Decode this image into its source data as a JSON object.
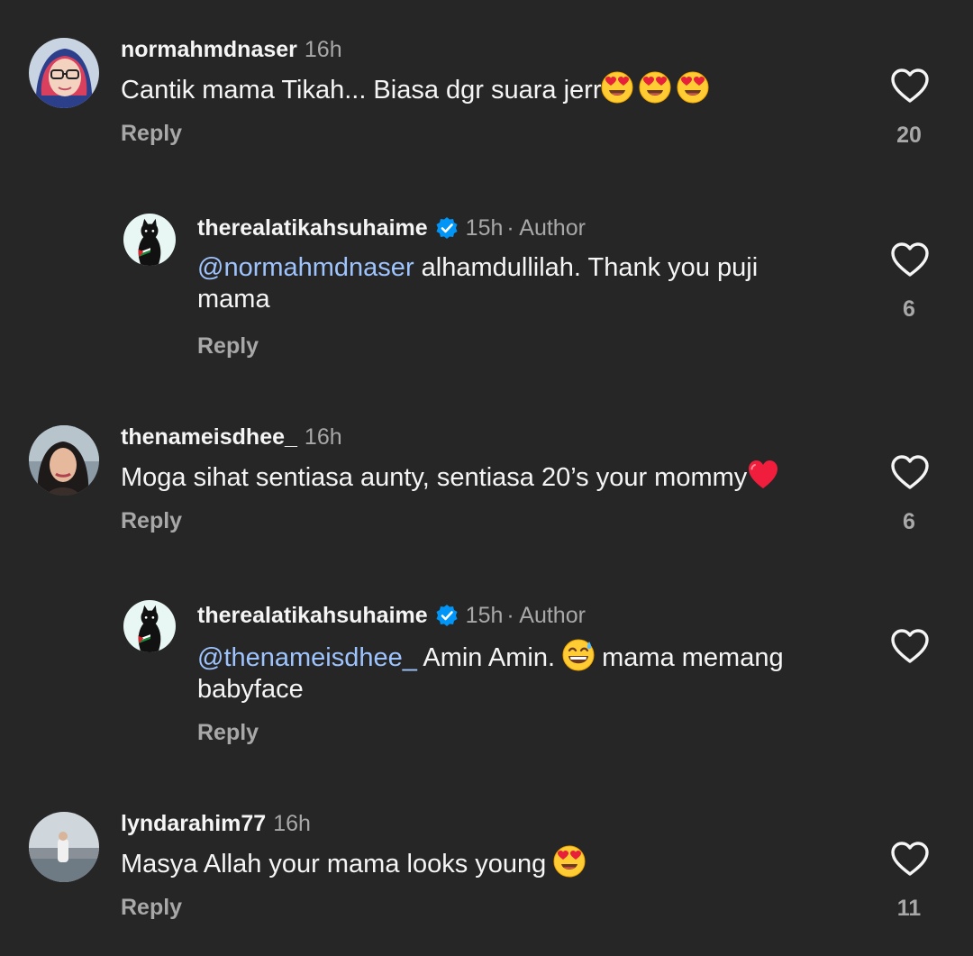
{
  "comments": [
    {
      "username": "normahmdnaser",
      "time": "16h",
      "text": "Cantik mama Tikah... Biasa dgr suara jerr",
      "emoji": [
        "heart-eyes",
        "heart-eyes",
        "heart-eyes"
      ],
      "reply_label": "Reply",
      "likes": "20"
    },
    {
      "username": "therealatikahsuhaime",
      "time": "15h",
      "author_label": "· Author",
      "mention": "@normahmdnaser",
      "text_line1": " alhamdullilah. Thank you puji",
      "text_line2": "mama",
      "reply_label": "Reply",
      "likes": "6"
    },
    {
      "username": "thenameisdhee_",
      "time": "16h",
      "text": "Moga sihat sentiasa aunty, sentiasa 20’s your mommy",
      "emoji": [
        "red-heart"
      ],
      "reply_label": "Reply",
      "likes": "6"
    },
    {
      "username": "therealatikahsuhaime",
      "time": "15h",
      "author_label": "· Author",
      "mention": "@thenameisdhee_",
      "text_a": " Amin Amin. ",
      "emoji": [
        "grinning-sweat"
      ],
      "text_b": " mama memang",
      "text_line2": "babyface",
      "reply_label": "Reply"
    },
    {
      "username": "lyndarahim77",
      "time": "16h",
      "text": "Masya Allah your mama looks young ",
      "emoji": [
        "heart-eyes"
      ],
      "reply_label": "Reply",
      "likes": "11"
    }
  ],
  "colors": {
    "background": "#262626",
    "text": "#f5f5f5",
    "secondary": "#a8a8a8",
    "mention": "#9ec4ff",
    "verified": "#0095f6"
  }
}
